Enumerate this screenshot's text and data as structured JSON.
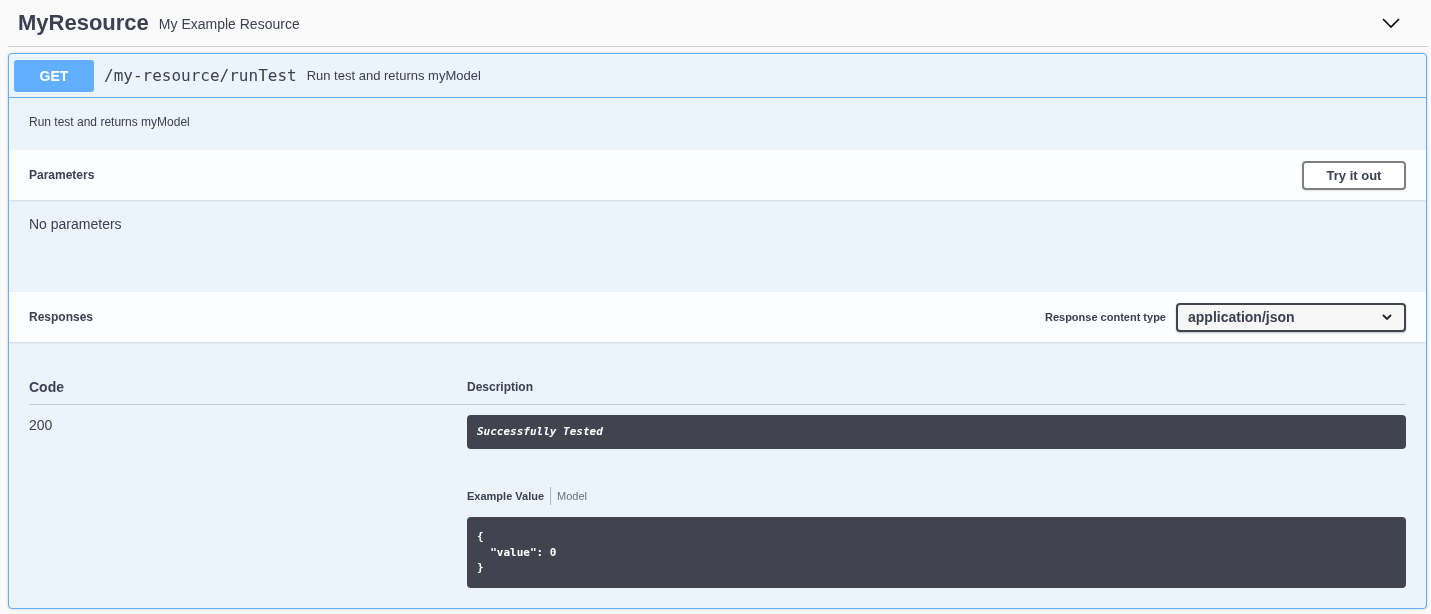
{
  "header": {
    "title": "MyResource",
    "description": "My Example Resource",
    "expanded": true
  },
  "operation": {
    "method": "GET",
    "path": "/my-resource/runTest",
    "summary": "Run test and returns myModel",
    "description": "Run test and returns myModel",
    "parameters": {
      "title": "Parameters",
      "button": "Try it out",
      "empty_text": "No parameters"
    },
    "responses": {
      "title": "Responses",
      "content_type_label": "Response content type",
      "content_type": "application/json",
      "columns": [
        "Code",
        "Description"
      ],
      "rows": [
        {
          "code": "200",
          "description": "Successfully Tested",
          "example_tabs": [
            {
              "label": "Example Value",
              "selected": true
            },
            {
              "label": "Model",
              "selected": false
            }
          ],
          "example": "{\n  \"value\": 0\n}"
        }
      ]
    }
  }
}
